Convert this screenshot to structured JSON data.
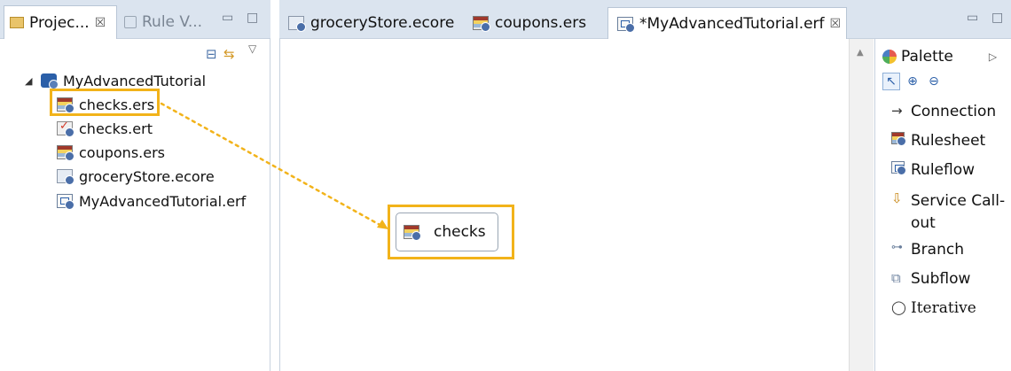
{
  "left_view": {
    "tab_project": "Projec...",
    "tab_rule": "Rule V...",
    "tab_close": "☒"
  },
  "tree": {
    "project": "MyAdvancedTutorial",
    "items": [
      {
        "label": "checks.ers",
        "icon": "rulesheet-icon"
      },
      {
        "label": "checks.ert",
        "icon": "ruletest-icon"
      },
      {
        "label": "coupons.ers",
        "icon": "rulesheet-icon"
      },
      {
        "label": "groceryStore.ecore",
        "icon": "ecore-icon"
      },
      {
        "label": "MyAdvancedTutorial.erf",
        "icon": "ruleflow-icon"
      }
    ]
  },
  "editor": {
    "tabs": [
      {
        "label": "groceryStore.ecore"
      },
      {
        "label": "coupons.ers"
      },
      {
        "label": "*MyAdvancedTutorial.erf",
        "close": "☒"
      }
    ],
    "node_label": "checks"
  },
  "palette": {
    "title": "Palette",
    "items": [
      {
        "label": "Connection",
        "icon": "arrow-right-icon"
      },
      {
        "label": "Rulesheet",
        "icon": "rulesheet-icon"
      },
      {
        "label": "Ruleflow",
        "icon": "ruleflow-icon"
      },
      {
        "label": "Service Call-",
        "label2": "out",
        "icon": "service-call-icon"
      },
      {
        "label": "Branch",
        "icon": "branch-icon"
      },
      {
        "label": "Subflow",
        "icon": "subflow-icon"
      },
      {
        "label": "Iterative",
        "icon": "iterative-icon"
      }
    ]
  },
  "colors": {
    "highlight": "#f2b31a",
    "tab_bar": "#dbe4ef"
  }
}
